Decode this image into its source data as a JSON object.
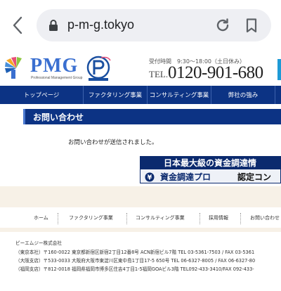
{
  "browser": {
    "url": "p-m-g.tokyo"
  },
  "header": {
    "logo_text": "PMG",
    "logo_subtitle": "Professional Management Group",
    "hours": "受付時間　9:30～18:00（土日休み）",
    "tel_label": "TEL.",
    "tel_number": "0120-901-680"
  },
  "nav": {
    "items": [
      {
        "label": "トップページ"
      },
      {
        "label": "ファクタリング事業"
      },
      {
        "label": "コンサルティング事業"
      },
      {
        "label": "弊社の強み"
      }
    ]
  },
  "page": {
    "title": "お問い合わせ",
    "message": "お問い合わせが送信されました。"
  },
  "banner": {
    "headline": "日本最大級の資金調達情",
    "brand": "資金調達プロ",
    "cert": "認定コン"
  },
  "footer_nav": {
    "items": [
      {
        "label": "ホーム"
      },
      {
        "label": "ファクタリング事業"
      },
      {
        "label": "コンサルティング事業"
      },
      {
        "label": "採用情報"
      },
      {
        "label": "お問い合わせ"
      }
    ]
  },
  "company": {
    "name": "ピーエムジー株式会社",
    "offices": [
      {
        "text": "（東京本社）〒160-0022 東京都新宿区新宿2丁目12番8号 ACN新宿ビル7階 TEL 03-5361-7503 / FAX 03-5361"
      },
      {
        "text": "（大阪支店）〒533-0033 大阪府大阪市東淀川区東中島1丁目17-5 650号 TEL 06-6327-8005 / FAX 06-6327-80"
      },
      {
        "text": "（福岡支店）〒812-0018 福岡県福岡市博多区住吉4丁目1-5福岡GOAビル3階 TEL092-433-3410/FAX 092-433-"
      }
    ]
  },
  "colors": {
    "nav_bg": "#0c3384",
    "logo_blue": "#3a6fd0",
    "band_beige": "#f7f1e7"
  }
}
